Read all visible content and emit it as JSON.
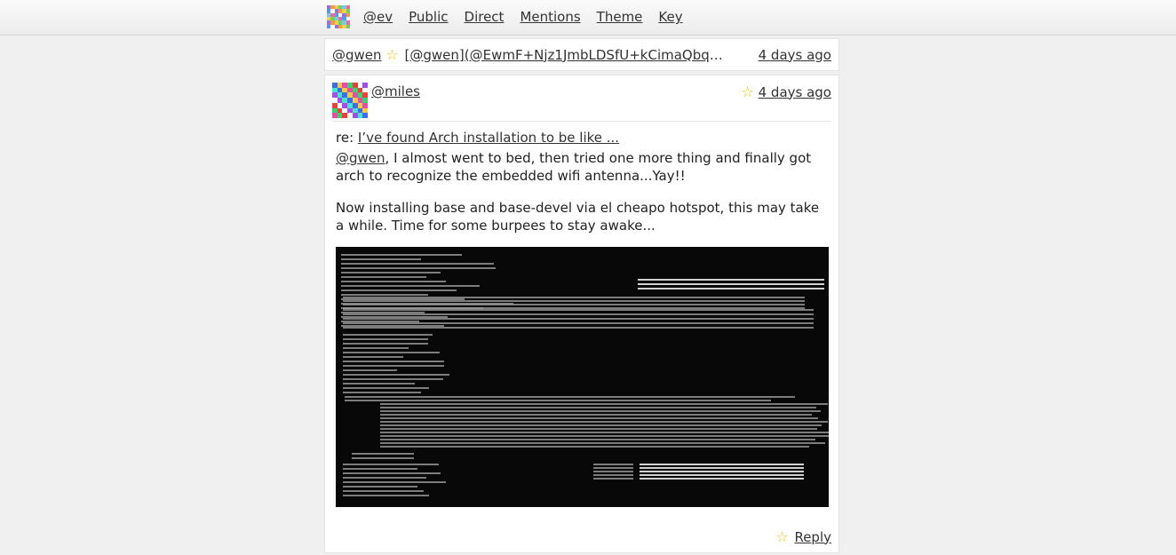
{
  "nav": {
    "logo_icon": "identicon-logo",
    "items": [
      "@ev",
      "Public",
      "Direct",
      "Mentions",
      "Theme",
      "Key"
    ]
  },
  "prev_post": {
    "author": "@gwen",
    "preview": "[@gwen](@EwmF+Njz1JmbLDSfU+kCimaQbqca9kq...",
    "time": "4 days ago",
    "star_icon": "star-icon"
  },
  "post": {
    "author": "@miles",
    "time": "4 days ago",
    "re_label": "re:",
    "re_link": "I’ve found Arch installation to be like ...",
    "mention": "@gwen",
    "para1_rest": ", I almost went to bed, then tried one more thing and finally got arch to recognize the embedded wifi antenna...Yay!!",
    "para2": "Now installing base and base-devel via el cheapo hotspot, this may take a while. Time for some burpees to stay awake...",
    "image_icon": "terminal-photo",
    "reply_label": "Reply"
  },
  "colors": {
    "accent_star": "#e8c21b",
    "background": "#f0f0f0",
    "card": "#ffffff"
  }
}
